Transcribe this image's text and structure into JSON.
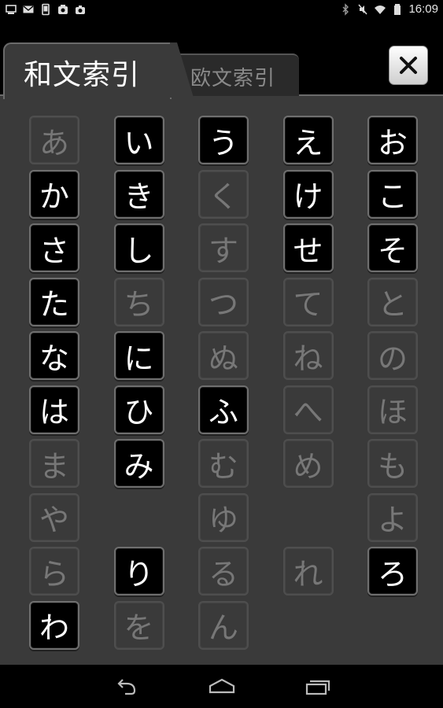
{
  "status_bar": {
    "time": "16:09",
    "left_icons": [
      "screen-icon",
      "mail-icon",
      "phone-icon",
      "app-icon",
      "camera-icon"
    ],
    "right_icons": [
      "bluetooth-icon",
      "mute-icon",
      "wifi-icon",
      "battery-icon"
    ]
  },
  "tabs": {
    "active": "和文索引",
    "inactive": "欧文索引"
  },
  "close_label": "close",
  "kana_rows": [
    [
      {
        "k": "あ",
        "on": false
      },
      {
        "k": "い",
        "on": true
      },
      {
        "k": "う",
        "on": true
      },
      {
        "k": "え",
        "on": true
      },
      {
        "k": "お",
        "on": true
      }
    ],
    [
      {
        "k": "か",
        "on": true
      },
      {
        "k": "き",
        "on": true
      },
      {
        "k": "く",
        "on": false
      },
      {
        "k": "け",
        "on": true
      },
      {
        "k": "こ",
        "on": true
      }
    ],
    [
      {
        "k": "さ",
        "on": true
      },
      {
        "k": "し",
        "on": true
      },
      {
        "k": "す",
        "on": false
      },
      {
        "k": "せ",
        "on": true
      },
      {
        "k": "そ",
        "on": true
      }
    ],
    [
      {
        "k": "た",
        "on": true
      },
      {
        "k": "ち",
        "on": false
      },
      {
        "k": "つ",
        "on": false
      },
      {
        "k": "て",
        "on": false
      },
      {
        "k": "と",
        "on": false
      }
    ],
    [
      {
        "k": "な",
        "on": true
      },
      {
        "k": "に",
        "on": true
      },
      {
        "k": "ぬ",
        "on": false
      },
      {
        "k": "ね",
        "on": false
      },
      {
        "k": "の",
        "on": false
      }
    ],
    [
      {
        "k": "は",
        "on": true
      },
      {
        "k": "ひ",
        "on": true
      },
      {
        "k": "ふ",
        "on": true
      },
      {
        "k": "へ",
        "on": false
      },
      {
        "k": "ほ",
        "on": false
      }
    ],
    [
      {
        "k": "ま",
        "on": false
      },
      {
        "k": "み",
        "on": true
      },
      {
        "k": "む",
        "on": false
      },
      {
        "k": "め",
        "on": false
      },
      {
        "k": "も",
        "on": false
      }
    ],
    [
      {
        "k": "や",
        "on": false
      },
      {
        "k": "",
        "on": false
      },
      {
        "k": "ゆ",
        "on": false
      },
      {
        "k": "",
        "on": false
      },
      {
        "k": "よ",
        "on": false
      }
    ],
    [
      {
        "k": "ら",
        "on": false
      },
      {
        "k": "り",
        "on": true
      },
      {
        "k": "る",
        "on": false
      },
      {
        "k": "れ",
        "on": false
      },
      {
        "k": "ろ",
        "on": true
      }
    ],
    [
      {
        "k": "わ",
        "on": true
      },
      {
        "k": "を",
        "on": false
      },
      {
        "k": "ん",
        "on": false
      },
      {
        "k": "",
        "on": false
      },
      {
        "k": "",
        "on": false
      }
    ]
  ],
  "nav": {
    "back": "back-icon",
    "home": "home-icon",
    "recents": "recents-icon"
  }
}
